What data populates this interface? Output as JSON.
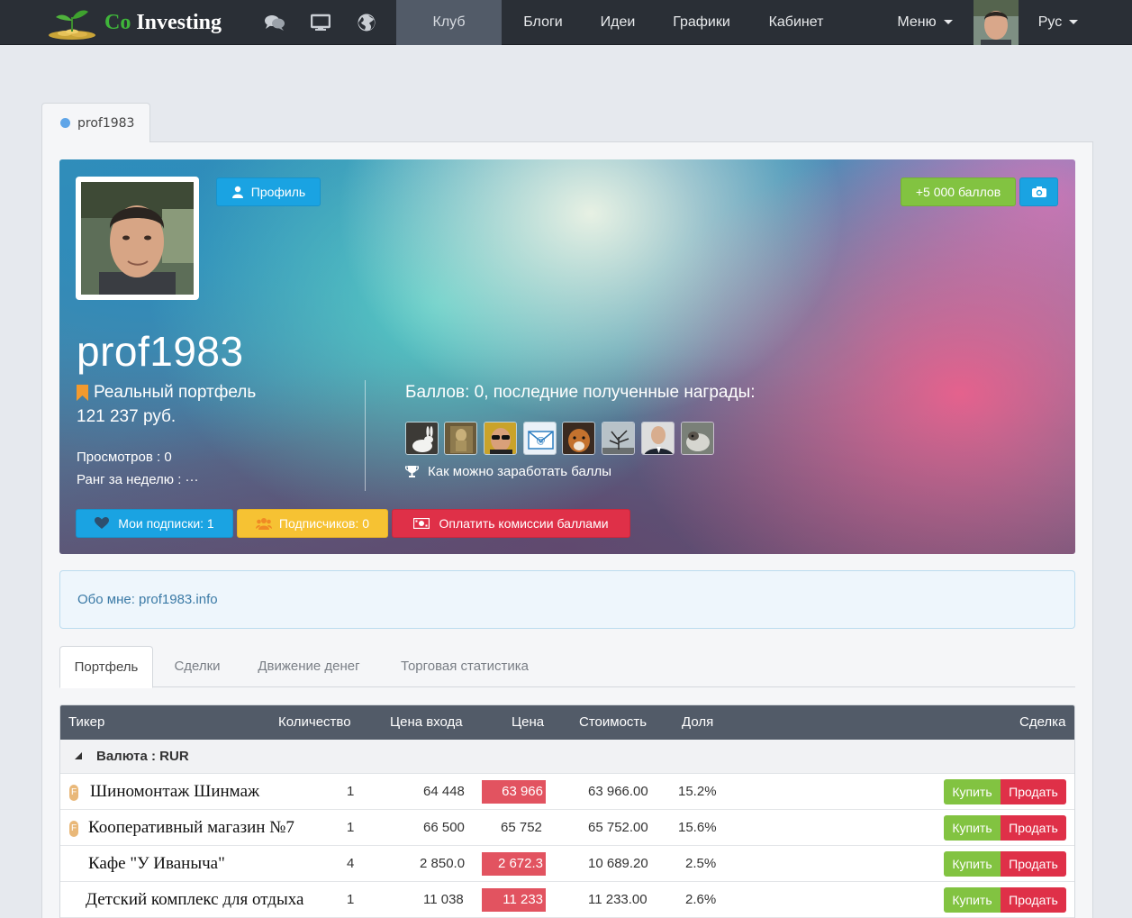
{
  "brand": {
    "co": "Co",
    "investing": "Investing"
  },
  "nav": {
    "club": "Клуб",
    "blogs": "Блоги",
    "ideas": "Идеи",
    "charts": "Графики",
    "cabinet": "Кабинет",
    "menu": "Меню",
    "lang": "Рус"
  },
  "tab_user": "prof1983",
  "profile": {
    "profile_btn": "Профиль",
    "bonus_btn": "+5 000 баллов",
    "username": "prof1983",
    "portfolio_type": "Реальный портфель",
    "portfolio_value": "121 237 руб.",
    "views": "Просмотров : 0",
    "rank": "Ранг за неделю : ···",
    "points_text": "Баллов: 0, последние полученные награды:",
    "how_to_earn": "Как можно заработать баллы",
    "subs_btn": "Мои подписки: 1",
    "followers_btn": "Подписчиков: 0",
    "pay_btn": "Оплатить комиссии баллами"
  },
  "about": "Обо мне: prof1983.info",
  "tabs": [
    "Портфель",
    "Сделки",
    "Движение денег",
    "Торговая статистика"
  ],
  "table": {
    "headers": {
      "ticker": "Тикер",
      "qty": "Количество",
      "entry": "Цена входа",
      "price": "Цена",
      "value": "Стоимость",
      "share": "Доля",
      "deal": "Сделка"
    },
    "group": "Валюта : RUR",
    "rows": [
      {
        "name": "Шиномонтаж Шинмаж",
        "badge": "F",
        "qty": "1",
        "entry": "64 448",
        "price": "63 966",
        "price_down": true,
        "value": "63 966.00",
        "share": "15.2%"
      },
      {
        "name": "Кооперативный магазин №7",
        "badge": "F",
        "qty": "1",
        "entry": "66 500",
        "price": "65 752",
        "price_down": false,
        "value": "65 752.00",
        "share": "15.6%"
      },
      {
        "name": "Кафе \"У Иваныча\"",
        "badge": "",
        "qty": "4",
        "entry": "2 850.0",
        "price": "2 672.3",
        "price_down": true,
        "value": "10 689.20",
        "share": "2.5%"
      },
      {
        "name": "Детский комплекс для отдыха",
        "badge": "",
        "qty": "1",
        "entry": "11 038",
        "price": "11 233",
        "price_down": true,
        "value": "11 233.00",
        "share": "2.6%"
      }
    ],
    "buy": "Купить",
    "sell": "Продать"
  },
  "colors": {
    "nav_bg": "#2a2f36",
    "nav_active": "#525b68",
    "blue": "#1aa3e2",
    "green": "#82c341",
    "yellow": "#f6c233",
    "red": "#df3048",
    "price_down": "#e25360"
  }
}
